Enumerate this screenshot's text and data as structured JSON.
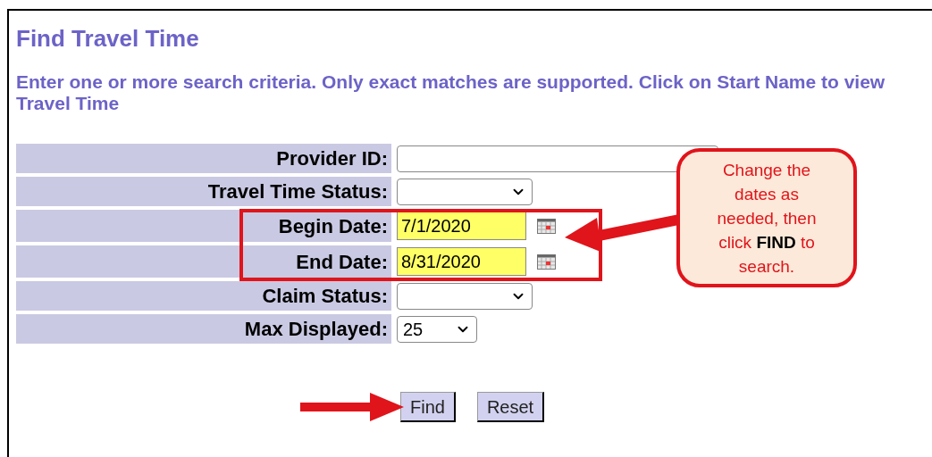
{
  "title": "Find Travel Time",
  "instructions": "Enter one or more search criteria. Only exact matches are supported. Click on Start Name to view Travel Time",
  "fields": [
    {
      "label": "Provider ID:",
      "kind": "text"
    },
    {
      "label": "Travel Time Status:",
      "kind": "select"
    },
    {
      "label": "Begin Date:",
      "kind": "date",
      "value": "7/1/2020",
      "highlighted": true
    },
    {
      "label": "End Date:",
      "kind": "date",
      "value": "8/31/2020",
      "highlighted": true
    },
    {
      "label": "Claim Status:",
      "kind": "select"
    },
    {
      "label": "Max Displayed:",
      "kind": "select",
      "value": "25",
      "short": true
    }
  ],
  "buttons": [
    "Find",
    "Reset"
  ],
  "callout": {
    "text": "Change the dates as needed, then click **FIND** to search."
  }
}
